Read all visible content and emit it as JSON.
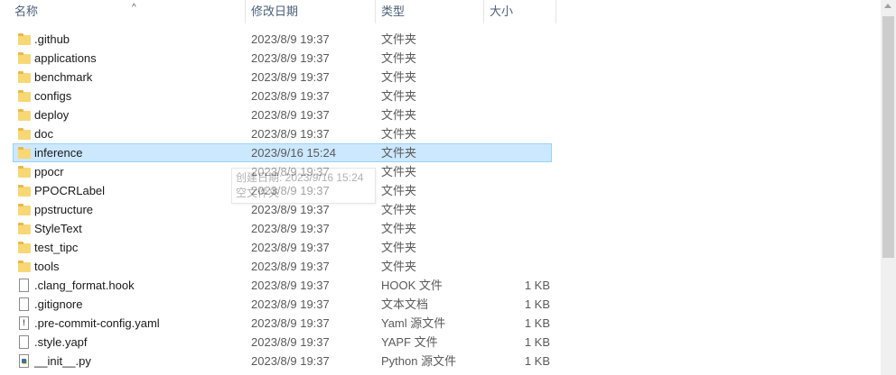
{
  "columns": {
    "name": "名称",
    "date": "修改日期",
    "type": "类型",
    "size": "大小"
  },
  "tooltip": {
    "line1": "创建日期: 2023/9/16 15:24",
    "line2": "空文件夹"
  },
  "files": [
    {
      "name": ".github",
      "date": "2023/8/9 19:37",
      "type": "文件夹",
      "size": "",
      "icon": "folder-icon"
    },
    {
      "name": "applications",
      "date": "2023/8/9 19:37",
      "type": "文件夹",
      "size": "",
      "icon": "folder-icon"
    },
    {
      "name": "benchmark",
      "date": "2023/8/9 19:37",
      "type": "文件夹",
      "size": "",
      "icon": "folder-icon"
    },
    {
      "name": "configs",
      "date": "2023/8/9 19:37",
      "type": "文件夹",
      "size": "",
      "icon": "folder-icon"
    },
    {
      "name": "deploy",
      "date": "2023/8/9 19:37",
      "type": "文件夹",
      "size": "",
      "icon": "folder-icon"
    },
    {
      "name": "doc",
      "date": "2023/8/9 19:37",
      "type": "文件夹",
      "size": "",
      "icon": "folder-icon"
    },
    {
      "name": "inference",
      "date": "2023/9/16 15:24",
      "type": "文件夹",
      "size": "",
      "icon": "folder-icon",
      "selected": true
    },
    {
      "name": "ppocr",
      "date": "2023/8/9 19:37",
      "type": "文件夹",
      "size": "",
      "icon": "folder-icon"
    },
    {
      "name": "PPOCRLabel",
      "date": "2023/8/9 19:37",
      "type": "文件夹",
      "size": "",
      "icon": "folder-icon"
    },
    {
      "name": "ppstructure",
      "date": "2023/8/9 19:37",
      "type": "文件夹",
      "size": "",
      "icon": "folder-icon"
    },
    {
      "name": "StyleText",
      "date": "2023/8/9 19:37",
      "type": "文件夹",
      "size": "",
      "icon": "folder-icon"
    },
    {
      "name": "test_tipc",
      "date": "2023/8/9 19:37",
      "type": "文件夹",
      "size": "",
      "icon": "folder-icon"
    },
    {
      "name": "tools",
      "date": "2023/8/9 19:37",
      "type": "文件夹",
      "size": "",
      "icon": "folder-icon"
    },
    {
      "name": ".clang_format.hook",
      "date": "2023/8/9 19:37",
      "type": "HOOK 文件",
      "size": "1 KB",
      "icon": "file-icon"
    },
    {
      "name": ".gitignore",
      "date": "2023/8/9 19:37",
      "type": "文本文档",
      "size": "1 KB",
      "icon": "file-icon"
    },
    {
      "name": ".pre-commit-config.yaml",
      "date": "2023/8/9 19:37",
      "type": "Yaml 源文件",
      "size": "1 KB",
      "icon": "yaml-icon"
    },
    {
      "name": ".style.yapf",
      "date": "2023/8/9 19:37",
      "type": "YAPF 文件",
      "size": "1 KB",
      "icon": "file-icon"
    },
    {
      "name": "__init__.py",
      "date": "2023/8/9 19:37",
      "type": "Python 源文件",
      "size": "1 KB",
      "icon": "python-file-icon"
    }
  ]
}
